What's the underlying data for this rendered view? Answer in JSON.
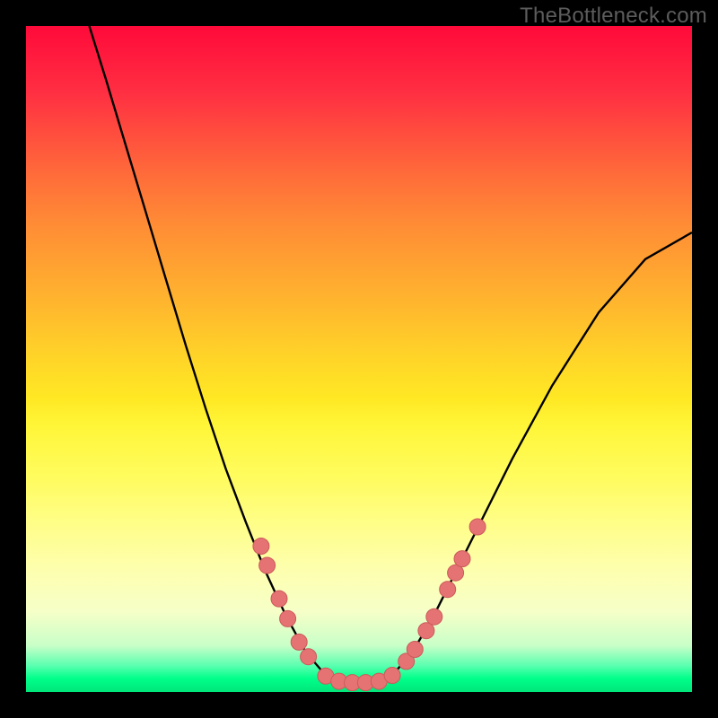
{
  "watermark": "TheBottleneck.com",
  "colors": {
    "frame": "#000000",
    "curve": "#000000",
    "marker_fill": "#e57373",
    "marker_stroke": "#cc5a5a"
  },
  "chart_data": {
    "type": "line",
    "title": "",
    "xlabel": "",
    "ylabel": "",
    "xlim": [
      0,
      100
    ],
    "ylim": [
      0,
      100
    ],
    "grid": false,
    "legend": null,
    "note": "No axes, tick labels, or numeric annotations in source image; values below are pixel-estimated relative positions (domain 0–100).",
    "series": [
      {
        "name": "curve",
        "style": "line",
        "points_xy": [
          [
            9.5,
            100.0
          ],
          [
            12.0,
            92.0
          ],
          [
            15.0,
            82.0
          ],
          [
            18.0,
            72.0
          ],
          [
            21.0,
            62.0
          ],
          [
            24.0,
            52.0
          ],
          [
            27.0,
            42.5
          ],
          [
            30.0,
            33.5
          ],
          [
            33.0,
            25.5
          ],
          [
            36.0,
            18.0
          ],
          [
            39.0,
            11.5
          ],
          [
            42.0,
            6.0
          ],
          [
            45.0,
            2.5
          ],
          [
            47.5,
            1.0
          ],
          [
            50.0,
            1.0
          ],
          [
            52.5,
            1.0
          ],
          [
            55.0,
            2.5
          ],
          [
            58.0,
            6.0
          ],
          [
            61.0,
            11.0
          ],
          [
            64.0,
            17.0
          ],
          [
            68.0,
            25.0
          ],
          [
            73.0,
            35.0
          ],
          [
            79.0,
            46.0
          ],
          [
            86.0,
            57.0
          ],
          [
            93.0,
            65.0
          ],
          [
            100.0,
            69.0
          ]
        ]
      },
      {
        "name": "markers",
        "style": "points",
        "points_xy": [
          [
            35.3,
            21.9
          ],
          [
            36.2,
            19.0
          ],
          [
            38.0,
            14.0
          ],
          [
            39.3,
            11.0
          ],
          [
            41.0,
            7.5
          ],
          [
            42.4,
            5.3
          ],
          [
            45.0,
            2.4
          ],
          [
            47.0,
            1.6
          ],
          [
            49.0,
            1.4
          ],
          [
            51.0,
            1.4
          ],
          [
            53.0,
            1.6
          ],
          [
            55.0,
            2.5
          ],
          [
            57.1,
            4.6
          ],
          [
            58.4,
            6.4
          ],
          [
            60.1,
            9.2
          ],
          [
            61.3,
            11.3
          ],
          [
            63.3,
            15.4
          ],
          [
            64.5,
            17.9
          ],
          [
            65.5,
            20.0
          ],
          [
            67.8,
            24.8
          ]
        ]
      }
    ]
  }
}
